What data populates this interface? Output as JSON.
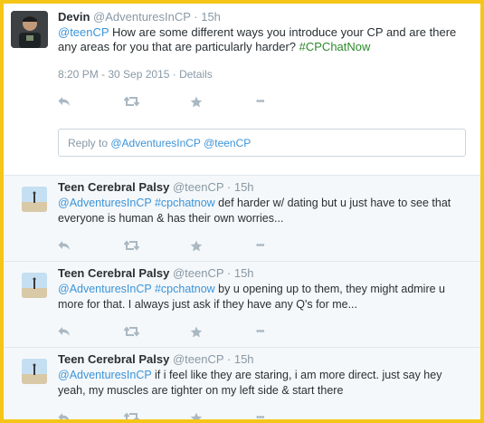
{
  "main_tweet": {
    "name": "Devin",
    "handle": "@AdventuresInCP",
    "time": "· 15h",
    "mention": "@teenCP",
    "text": " How are some different ways you introduce your CP and are there any areas for you that are particularly harder? ",
    "hashtag": "#CPChatNow",
    "timestamp": "8:20 PM - 30 Sep 2015",
    "details_sep": " · ",
    "details": "Details",
    "more": "•••"
  },
  "reply_box": {
    "prefix": "Reply to ",
    "mention1": "@AdventuresInCP",
    "mention2": "@teenCP"
  },
  "replies": [
    {
      "name": "Teen Cerebral Palsy",
      "handle": "@teenCP",
      "time": "· 15h",
      "mention": "@AdventuresInCP",
      "hashtag": " #cpchatnow",
      "text": " def harder w/ dating but u just have to see that everyone is human & has their own worries...",
      "more": "•••"
    },
    {
      "name": "Teen Cerebral Palsy",
      "handle": "@teenCP",
      "time": "· 15h",
      "mention": "@AdventuresInCP",
      "hashtag": " #cpchatnow",
      "text": " by u opening up to them, they might admire u more for that. I always just ask if they have any Q's for me...",
      "more": "•••"
    },
    {
      "name": "Teen Cerebral Palsy",
      "handle": "@teenCP",
      "time": "· 15h",
      "mention": "@AdventuresInCP",
      "hashtag": "",
      "text": " if i feel like they are staring, i am more direct. just say hey yeah, my muscles are tighter on my left side & start there",
      "more": "•••"
    }
  ],
  "colors": {
    "frame": "#f5c518",
    "link": "#3b94d9",
    "hashtag_main": "#2d8a2d",
    "icon": "#aab8c2"
  }
}
